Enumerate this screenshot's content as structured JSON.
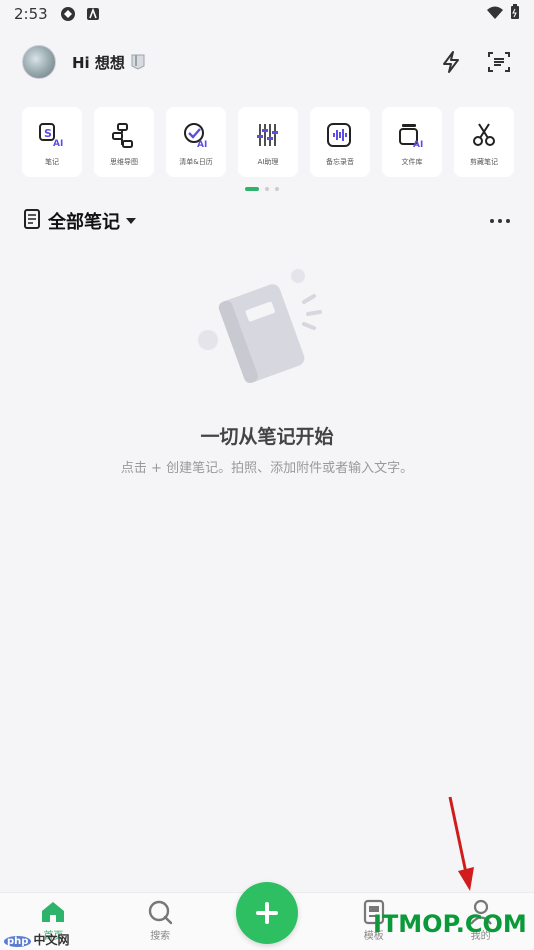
{
  "status_bar": {
    "time": "2:53"
  },
  "header": {
    "greeting": "Hi 想想"
  },
  "tools": [
    {
      "label": "笔记",
      "icon": "note-ai-icon"
    },
    {
      "label": "思维导图",
      "icon": "mindmap-icon"
    },
    {
      "label": "清单&日历",
      "icon": "checklist-ai-icon"
    },
    {
      "label": "AI助理",
      "icon": "ai-assistant-icon"
    },
    {
      "label": "备忘录音",
      "icon": "voice-memo-icon"
    },
    {
      "label": "文件库",
      "icon": "file-library-ai-icon"
    },
    {
      "label": "剪藏笔记",
      "icon": "scissors-icon"
    }
  ],
  "notes": {
    "title": "全部笔记"
  },
  "empty_state": {
    "title": "一切从笔记开始",
    "subtitle": "点击 + 创建笔记。拍照、添加附件或者输入文字。"
  },
  "bottom_nav": [
    {
      "label": "首页",
      "icon": "home-icon",
      "active": true
    },
    {
      "label": "搜索",
      "icon": "search-icon",
      "active": false
    },
    {
      "label": "模板",
      "icon": "template-icon",
      "active": false
    },
    {
      "label": "我的",
      "icon": "profile-icon",
      "active": false
    }
  ],
  "watermarks": {
    "left_brand": "php",
    "left_text": "中文网",
    "right_text": "ITMOP.COM"
  },
  "colors": {
    "accent": "#2fbf63",
    "background": "#f5f5f7",
    "ai_purple": "#5b4ee0"
  }
}
